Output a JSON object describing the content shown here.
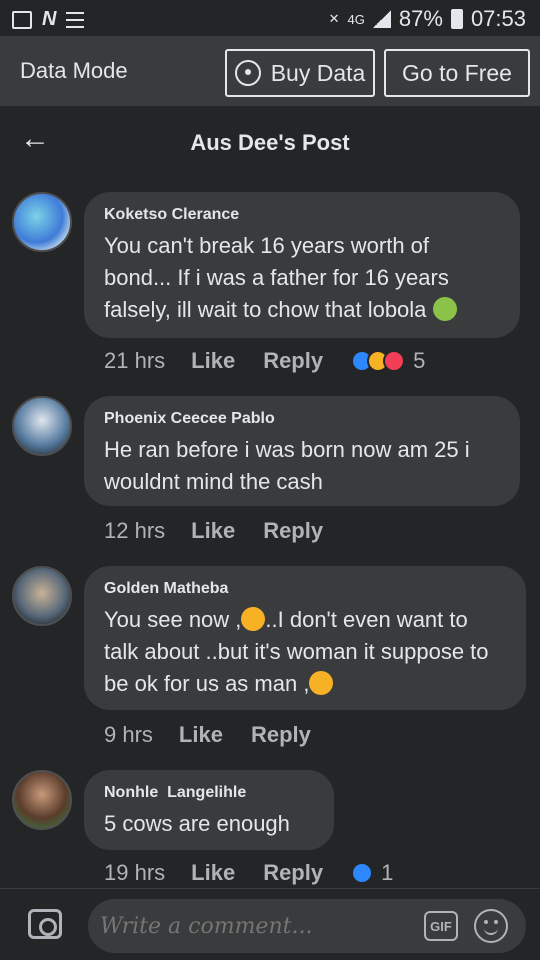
{
  "status_bar": {
    "network": "4G",
    "battery": "87%",
    "time": "07:53"
  },
  "data_bar": {
    "label": "Data Mode",
    "buy_data": "Buy Data",
    "go_to_free": "Go to Free"
  },
  "header": {
    "title": "Aus Dee's Post"
  },
  "comments": [
    {
      "name": "Koketso Clerance",
      "text": "You can't break 16 years worth of bond... If i was a father for 16 years falsely, ill wait to chow that lobola",
      "time": "21 hrs",
      "like": "Like",
      "reply": "Reply",
      "reaction_count": "5"
    },
    {
      "name": "Phoenix Ceecee Pablo",
      "text": "He ran before i was born now am 25 i wouldnt mind the cash",
      "time": "12 hrs",
      "like": "Like",
      "reply": "Reply"
    },
    {
      "name": "Golden Matheba",
      "text_1": "You see now ,",
      "text_2": "..I don't even want to talk about ..but it's woman it suppose to be ok for us as man ,",
      "time": "9 hrs",
      "like": "Like",
      "reply": "Reply"
    },
    {
      "name": "Nonhle  Langelihle",
      "text": "5 cows are enough",
      "time": "19 hrs",
      "like": "Like",
      "reply": "Reply",
      "reaction_count": "1"
    }
  ],
  "composer": {
    "placeholder": "Write a comment...",
    "gif_label": "GIF"
  },
  "colors": {
    "background": "#242526",
    "bubble": "#3a3b3c",
    "like_blue": "#2d88ff",
    "love_red": "#f33e58"
  }
}
